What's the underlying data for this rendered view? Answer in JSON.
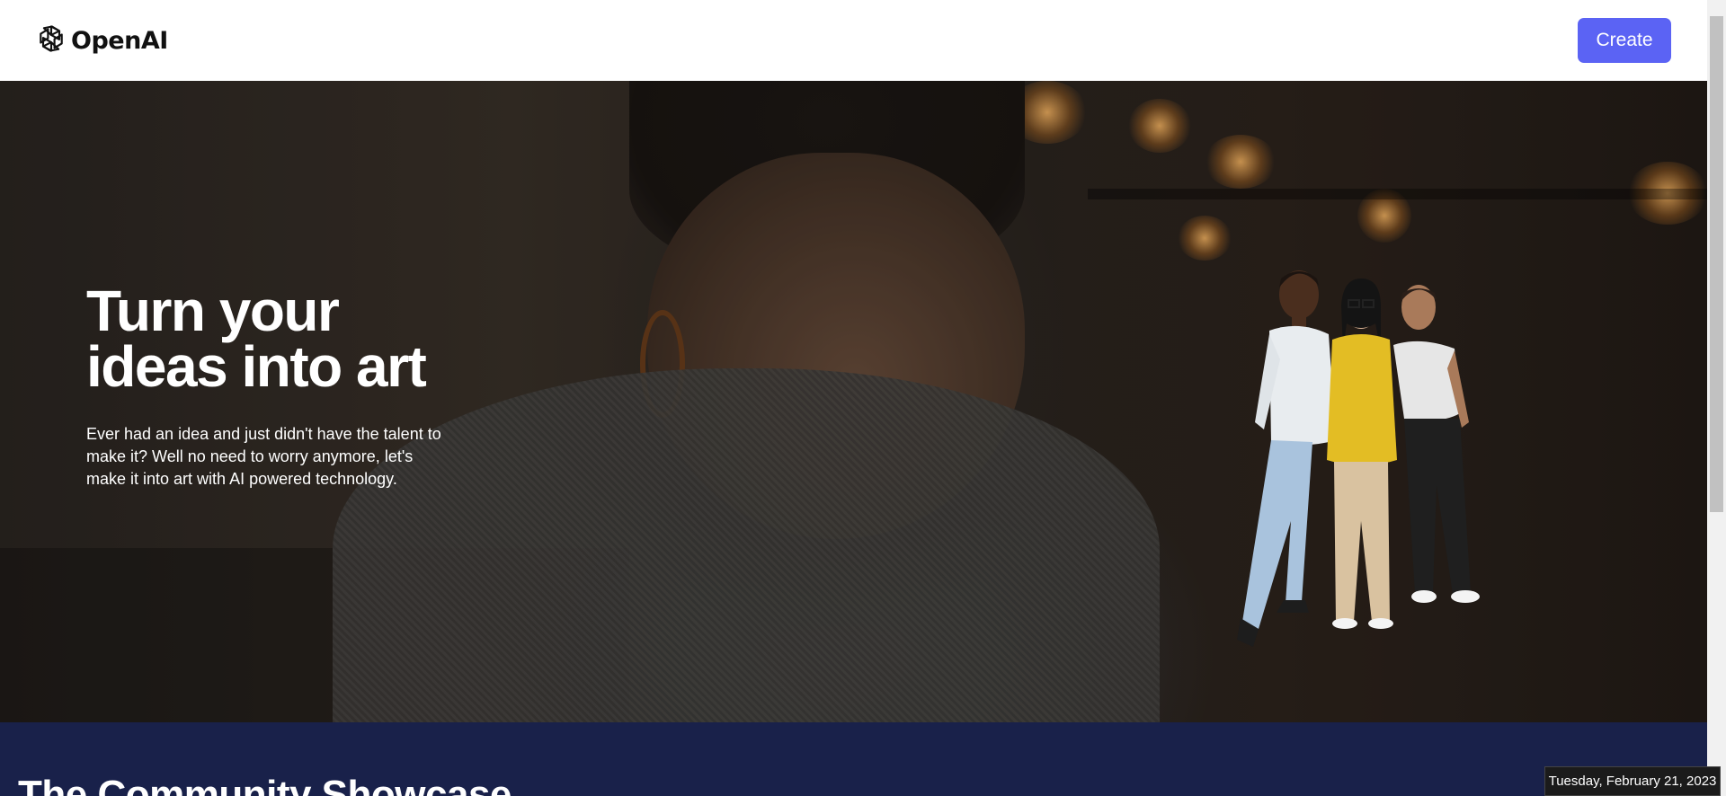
{
  "header": {
    "brand": "OpenAI",
    "logo_icon": "openai-logo-icon",
    "create_label": "Create"
  },
  "hero": {
    "title": "Turn your ideas into art",
    "description": "Ever had an idea and just didn't have the talent to make it? Well no need to worry anymore, let's make it into art with AI powered technology."
  },
  "showcase": {
    "title": "The Community Showcase"
  },
  "taskbar": {
    "date": "Tuesday, February 21, 2023"
  },
  "colors": {
    "accent": "#5b63f4",
    "showcase_bg": "#19214a"
  }
}
